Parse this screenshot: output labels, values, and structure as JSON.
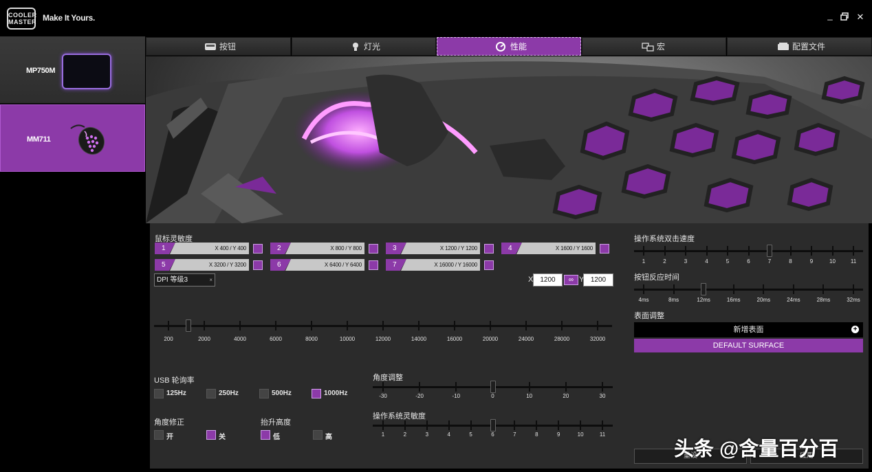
{
  "app": {
    "logo_text_1": "COOLER",
    "logo_text_2": "MASTER",
    "tagline": "Make It Yours.",
    "window": {
      "minimize": "_",
      "maximize": "▫",
      "close": "✕"
    }
  },
  "devices": [
    {
      "name": "MP750M",
      "selected": false
    },
    {
      "name": "MM711",
      "selected": true
    }
  ],
  "tabs": [
    {
      "label": "按钮",
      "icon": "button-icon",
      "active": false
    },
    {
      "label": "灯光",
      "icon": "lighting-icon",
      "active": false
    },
    {
      "label": "性能",
      "icon": "performance-icon",
      "active": true
    },
    {
      "label": "宏",
      "icon": "macro-icon",
      "active": false
    },
    {
      "label": "配置文件",
      "icon": "profile-icon",
      "active": false
    }
  ],
  "sensitivity": {
    "title": "鼠标灵敏度",
    "levels": [
      {
        "num": "1",
        "value": "X 400 / Y 400"
      },
      {
        "num": "2",
        "value": "X 800 / Y 800"
      },
      {
        "num": "3",
        "value": "X 1200 / Y 1200"
      },
      {
        "num": "4",
        "value": "X 1600 / Y 1600"
      },
      {
        "num": "5",
        "value": "X 3200 / Y 3200"
      },
      {
        "num": "6",
        "value": "X 6400 / Y 6400"
      },
      {
        "num": "7",
        "value": "X 16000 / Y 16000"
      }
    ],
    "dropdown": "DPI 等级3",
    "dropdown_clear": "×",
    "x_label": "X",
    "x_value": "1200",
    "y_label": "Y",
    "y_value": "1200",
    "link_icon": "∞",
    "slider_labels": [
      "200",
      "2000",
      "4000",
      "6000",
      "8000",
      "10000",
      "12000",
      "14000",
      "16000",
      "20000",
      "24000",
      "28000",
      "32000"
    ],
    "slider_value": 1200
  },
  "polling": {
    "title": "USB 轮询率",
    "options": [
      {
        "label": "125Hz",
        "checked": false
      },
      {
        "label": "250Hz",
        "checked": false
      },
      {
        "label": "500Hz",
        "checked": false
      },
      {
        "label": "1000Hz",
        "checked": true
      }
    ]
  },
  "angle_snap": {
    "title": "角度修正",
    "options": [
      {
        "label": "开",
        "checked": false
      },
      {
        "label": "关",
        "checked": true
      }
    ]
  },
  "lift_off": {
    "title": "抬升高度",
    "options": [
      {
        "label": "低",
        "checked": true
      },
      {
        "label": "高",
        "checked": false
      }
    ]
  },
  "angle_tune": {
    "title": "角度调整",
    "labels": [
      "-30",
      "-20",
      "-10",
      "0",
      "10",
      "20",
      "30"
    ],
    "value": 0
  },
  "os_sensitivity": {
    "title": "操作系统灵敏度",
    "labels": [
      "1",
      "2",
      "3",
      "4",
      "5",
      "6",
      "7",
      "8",
      "9",
      "10",
      "11"
    ],
    "value": 6
  },
  "double_click": {
    "title": "操作系统双击速度",
    "labels": [
      "1",
      "2",
      "3",
      "4",
      "5",
      "6",
      "7",
      "8",
      "9",
      "10",
      "11"
    ],
    "value": 7
  },
  "response": {
    "title": "按钮反应时间",
    "labels": [
      "4ms",
      "8ms",
      "12ms",
      "16ms",
      "20ms",
      "24ms",
      "28ms",
      "32ms"
    ],
    "value": 3
  },
  "surface": {
    "title": "表面调整",
    "add_label": "新增表面",
    "add_icon": "+",
    "default_label": "DEFAULT SURFACE"
  },
  "footer": {
    "reset": "重设",
    "apply": "应用",
    "watermark": "头条 @含量百分百"
  },
  "colors": {
    "accent": "#8c3aa8",
    "panel": "#2b2b2b"
  }
}
